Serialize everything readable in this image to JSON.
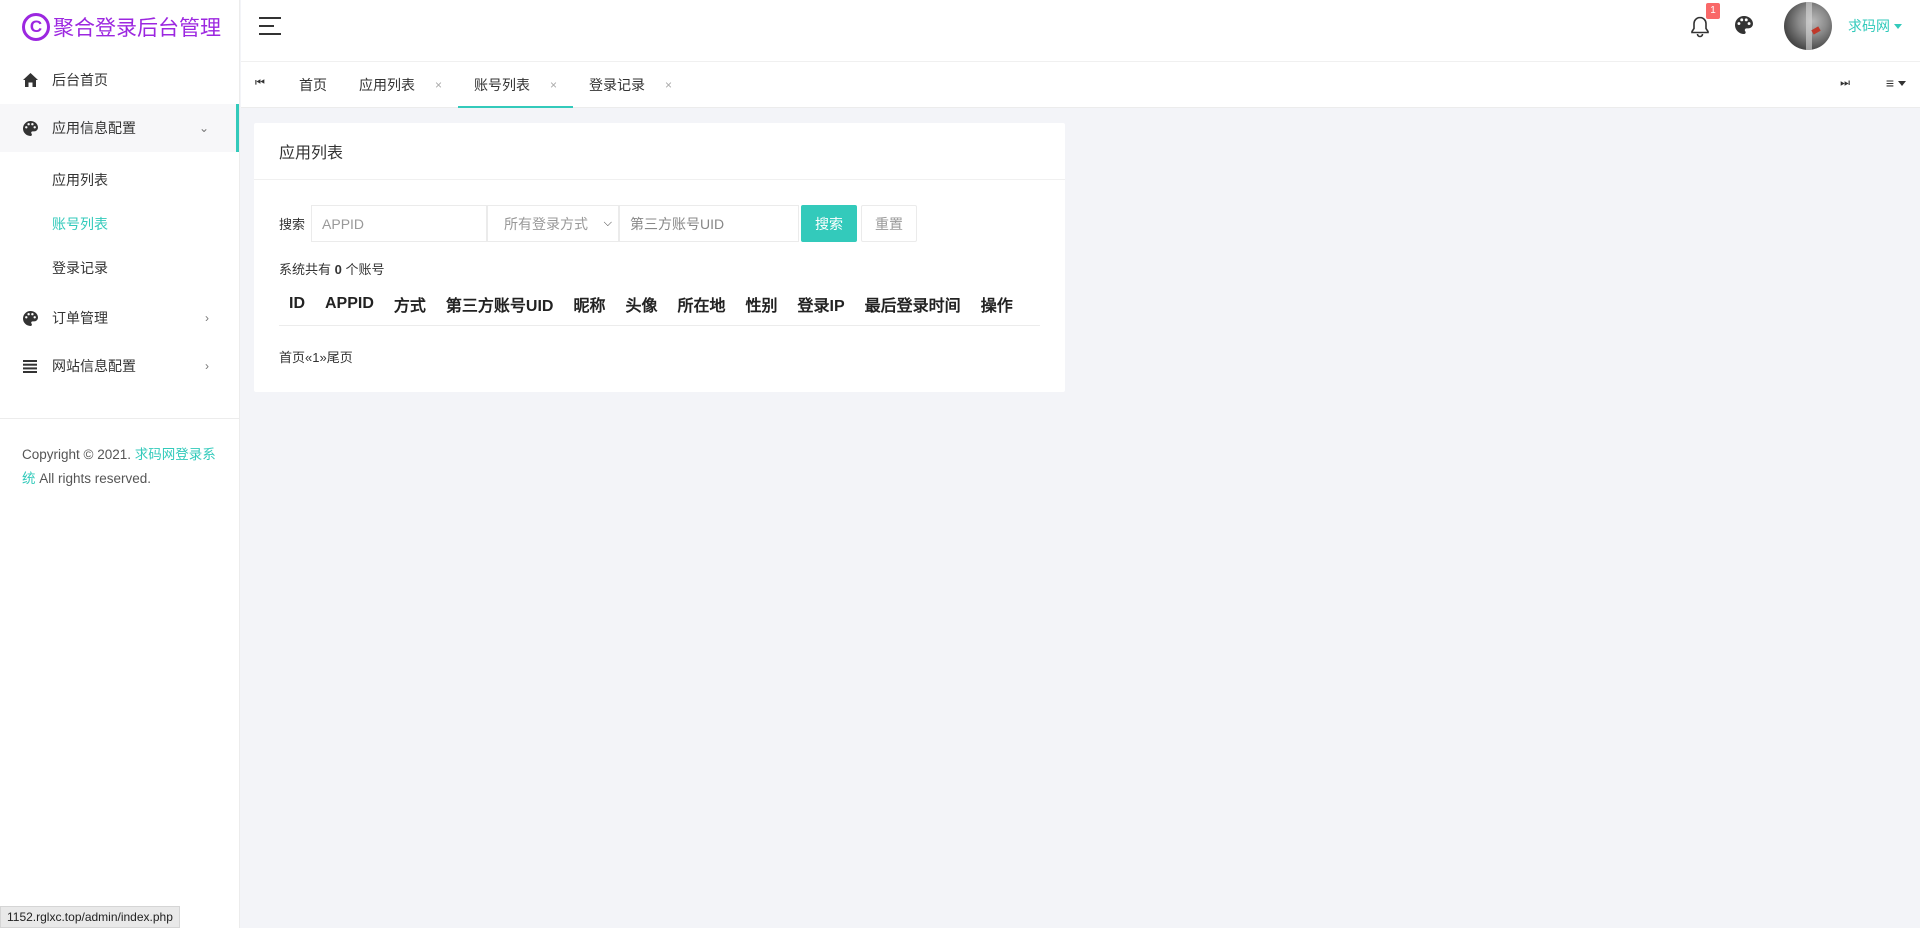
{
  "app": {
    "logo_glyph": "C",
    "title": "聚合登录后台管理"
  },
  "sidebar": {
    "items": [
      {
        "label": "后台首页",
        "icon": "home-icon"
      },
      {
        "label": "应用信息配置",
        "icon": "palette-icon",
        "open": true
      },
      {
        "label": "订单管理",
        "icon": "palette-icon"
      },
      {
        "label": "网站信息配置",
        "icon": "list-icon"
      }
    ],
    "sub_items": [
      {
        "label": "应用列表"
      },
      {
        "label": "账号列表",
        "active": true
      },
      {
        "label": "登录记录"
      }
    ],
    "copyright_prefix": "Copyright © 2021. ",
    "copyright_link": "求码网登录系统",
    "copyright_suffix": " All rights reserved."
  },
  "topbar": {
    "notification_count": "1",
    "username": "求码网"
  },
  "tabs": {
    "items": [
      {
        "label": "首页",
        "closable": false
      },
      {
        "label": "应用列表",
        "closable": true
      },
      {
        "label": "账号列表",
        "closable": true,
        "active": true
      },
      {
        "label": "登录记录",
        "closable": true
      }
    ],
    "close_glyph": "×"
  },
  "card": {
    "title": "应用列表",
    "search_label": "搜索",
    "appid_placeholder": "APPID",
    "login_method_selected": "所有登录方式",
    "uid_placeholder": "第三方账号UID",
    "search_button": "搜索",
    "reset_button": "重置",
    "summary_prefix": "系统共有 ",
    "summary_count": "0",
    "summary_suffix": " 个账号",
    "columns": [
      "ID",
      "APPID",
      "方式",
      "第三方账号UID",
      "昵称",
      "头像",
      "所在地",
      "性别",
      "登录IP",
      "最后登录时间",
      "操作"
    ],
    "pager": "首页«1»尾页"
  },
  "statusbar": {
    "url": "1152.rglxc.top/admin/index.php"
  },
  "colors": {
    "accent": "#33cabb",
    "brand": "#9c27e0",
    "badge": "#f96868",
    "background": "#f3f4f8"
  }
}
